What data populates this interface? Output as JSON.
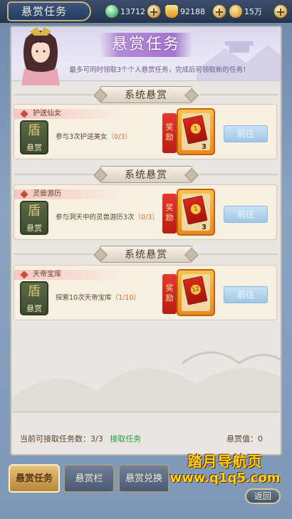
{
  "header": {
    "title": "悬赏任务",
    "resources": [
      {
        "name": "jade",
        "value": "13712",
        "icon": "jade-coin-icon"
      },
      {
        "name": "gold-ingot",
        "value": "92188",
        "icon": "gold-ingot-icon"
      },
      {
        "name": "copper",
        "value": "15万",
        "icon": "copper-coin-icon"
      }
    ]
  },
  "banner": {
    "title": "悬赏任务",
    "description": "最多可同时领取3个个人悬赏任务，完成后可领取新的任务！"
  },
  "section_title": "系统悬赏",
  "tasks": [
    {
      "name": "护送仙女",
      "emblem_top": "盾",
      "emblem_bottom": "悬赏",
      "desc": "参与3次护送美女",
      "progress": "（0/3）",
      "reward_label": "奖励",
      "reward_item_text": "1",
      "reward_qty": "3",
      "button": "前往"
    },
    {
      "name": "灵兽游历",
      "emblem_top": "盾",
      "emblem_bottom": "悬赏",
      "desc": "参与洞天中的灵兽游历3次",
      "progress": "（0/3）",
      "reward_label": "奖励",
      "reward_item_text": "1",
      "reward_qty": "3",
      "button": "前往"
    },
    {
      "name": "天帝宝库",
      "emblem_top": "盾",
      "emblem_bottom": "悬赏",
      "desc": "探索10次天帝宝库",
      "progress": "（1/10）",
      "reward_label": "奖励",
      "reward_item_text": "12",
      "reward_qty": "",
      "button": "前往"
    }
  ],
  "footer": {
    "count_label": "当前可接取任务数：3/3",
    "accept_link": "接取任务",
    "bounty_value": "悬赏值：0"
  },
  "tabs": [
    "悬赏任务",
    "悬赏栏",
    "悬赏兑换"
  ],
  "active_tab": 0,
  "watermark": {
    "line1": "踏月导航页",
    "line2": "www.q1q5.com"
  },
  "back_button": "返回",
  "colors": {
    "accent_green": "#2f9b3a",
    "progress_orange": "#d66d2f",
    "reward_red": "#c4160c"
  }
}
